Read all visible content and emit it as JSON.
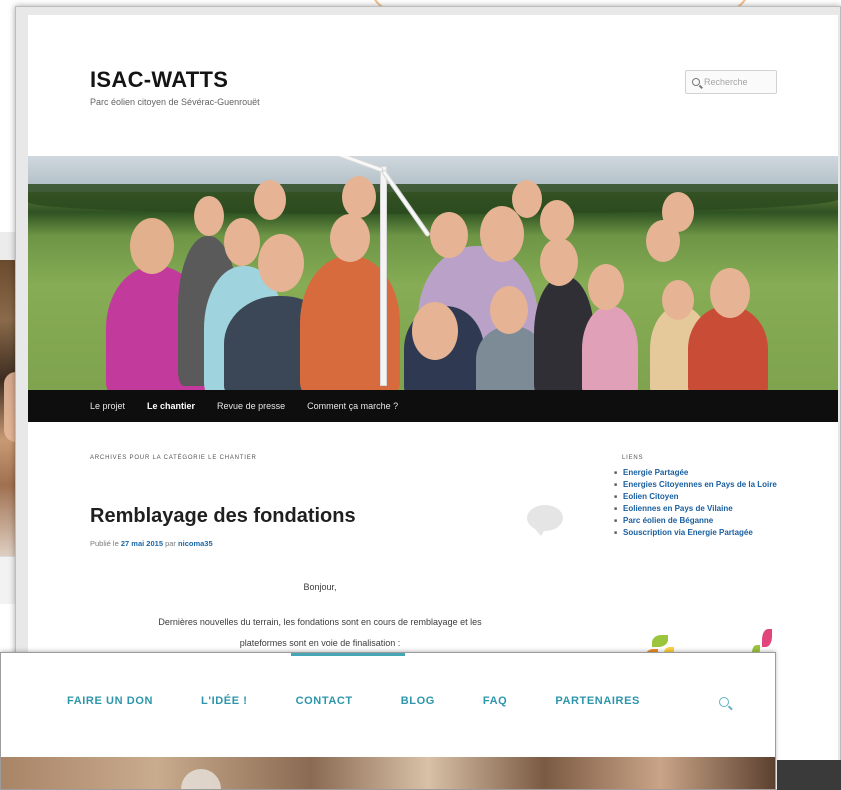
{
  "site": {
    "title": "ISAC-WATTS",
    "description": "Parc éolien citoyen de Sévérac-Guenrouët"
  },
  "search": {
    "placeholder": "Recherche"
  },
  "nav": {
    "items": [
      {
        "label": "Le projet",
        "active": false
      },
      {
        "label": "Le chantier",
        "active": true
      },
      {
        "label": "Revue de presse",
        "active": false
      },
      {
        "label": "Comment ça marche ?",
        "active": false
      }
    ]
  },
  "archive": {
    "label": "ARCHIVES POUR LA CATÉGORIE LE CHANTIER"
  },
  "post": {
    "title": "Remblayage des fondations",
    "meta_prefix": "Publié le",
    "date": "27 mai 2015",
    "meta_by": "par",
    "author": "nicoma35",
    "greeting": "Bonjour,",
    "body_line1": "Dernières nouvelles du terrain, les fondations sont en cours de remblayage et les",
    "body_line2": "plateformes sont en voie de finalisation :"
  },
  "sidebar": {
    "title": "LIENS",
    "links": [
      "Energie Partagée",
      "Energies Citoyennes en Pays de la Loire",
      "Eolien Citoyen",
      "Eoliennes en Pays de Vilaine",
      "Parc éolien de Béganne",
      "Souscription via Energie Partagée"
    ]
  },
  "front_window": {
    "nav": [
      "FAIRE UN DON",
      "L'IDÉE !",
      "CONTACT",
      "BLOG",
      "FAQ",
      "PARTENAIRES"
    ],
    "accent_color": "#46a6b5"
  },
  "colors": {
    "link": "#1a5fa0",
    "navbar_bg": "#0e0e0e",
    "front_nav": "#2d96ab"
  }
}
